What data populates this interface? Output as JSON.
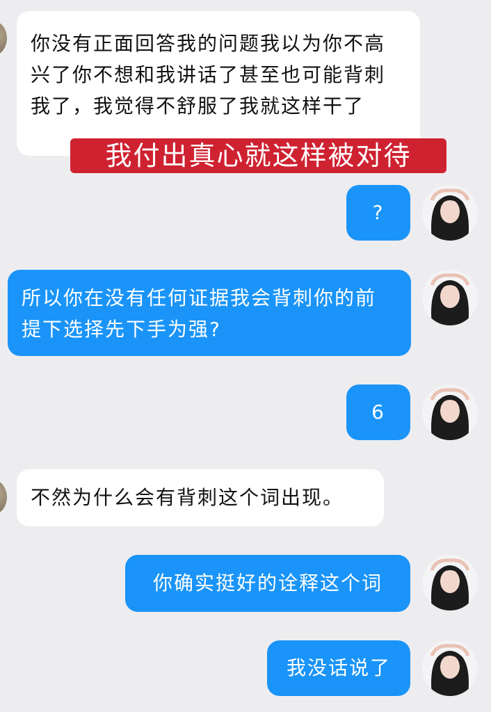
{
  "messages": [
    {
      "side": "in",
      "text": "你没有正面回答我的问题我以为你不高兴了你不想和我讲话了甚至也可能背刺我了，我觉得不舒服了我就这样干了"
    },
    {
      "side": "out",
      "text": "?"
    },
    {
      "side": "out",
      "text": "所以你在没有任何证据我会背刺你的前提下选择先下手为强?"
    },
    {
      "side": "out",
      "text": "6"
    },
    {
      "side": "in",
      "text": "不然为什么会有背刺这个词出现。"
    },
    {
      "side": "out",
      "text": "你确实挺好的诠释这个词"
    },
    {
      "side": "out",
      "text": "我没话说了"
    }
  ],
  "caption": {
    "text": "我付出真心就这样被对待"
  },
  "colors": {
    "background": "#ededf0",
    "incoming": "#ffffff",
    "outgoing": "#1a94f8",
    "caption": "#cf2231"
  }
}
